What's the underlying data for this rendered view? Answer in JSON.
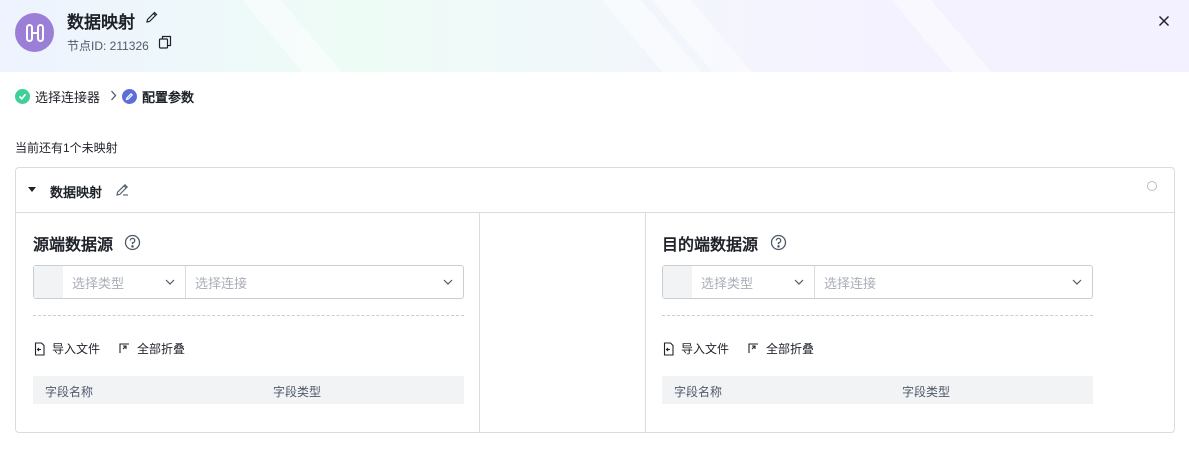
{
  "header": {
    "title": "数据映射",
    "node_id_label": "节点ID: 211326",
    "icons": [
      "mapping-avatar-icon",
      "edit-icon",
      "copy-icon",
      "close-icon"
    ],
    "avatar_color": "#9b7fd6"
  },
  "steps": [
    {
      "label": "选择连接器",
      "status": "done",
      "color": "#3ecf9a"
    },
    {
      "label": "配置参数",
      "status": "current",
      "color": "#5b6fd9"
    }
  ],
  "hint": "当前还有1个未映射",
  "panel": {
    "title": "数据映射",
    "source": {
      "title": "源端数据源",
      "type_placeholder": "选择类型",
      "conn_placeholder": "选择连接",
      "import_label": "导入文件",
      "collapse_label": "全部折叠",
      "col_name": "字段名称",
      "col_type": "字段类型"
    },
    "target": {
      "title": "目的端数据源",
      "type_placeholder": "选择类型",
      "conn_placeholder": "选择连接",
      "import_label": "导入文件",
      "collapse_label": "全部折叠",
      "col_name": "字段名称",
      "col_type": "字段类型"
    }
  }
}
